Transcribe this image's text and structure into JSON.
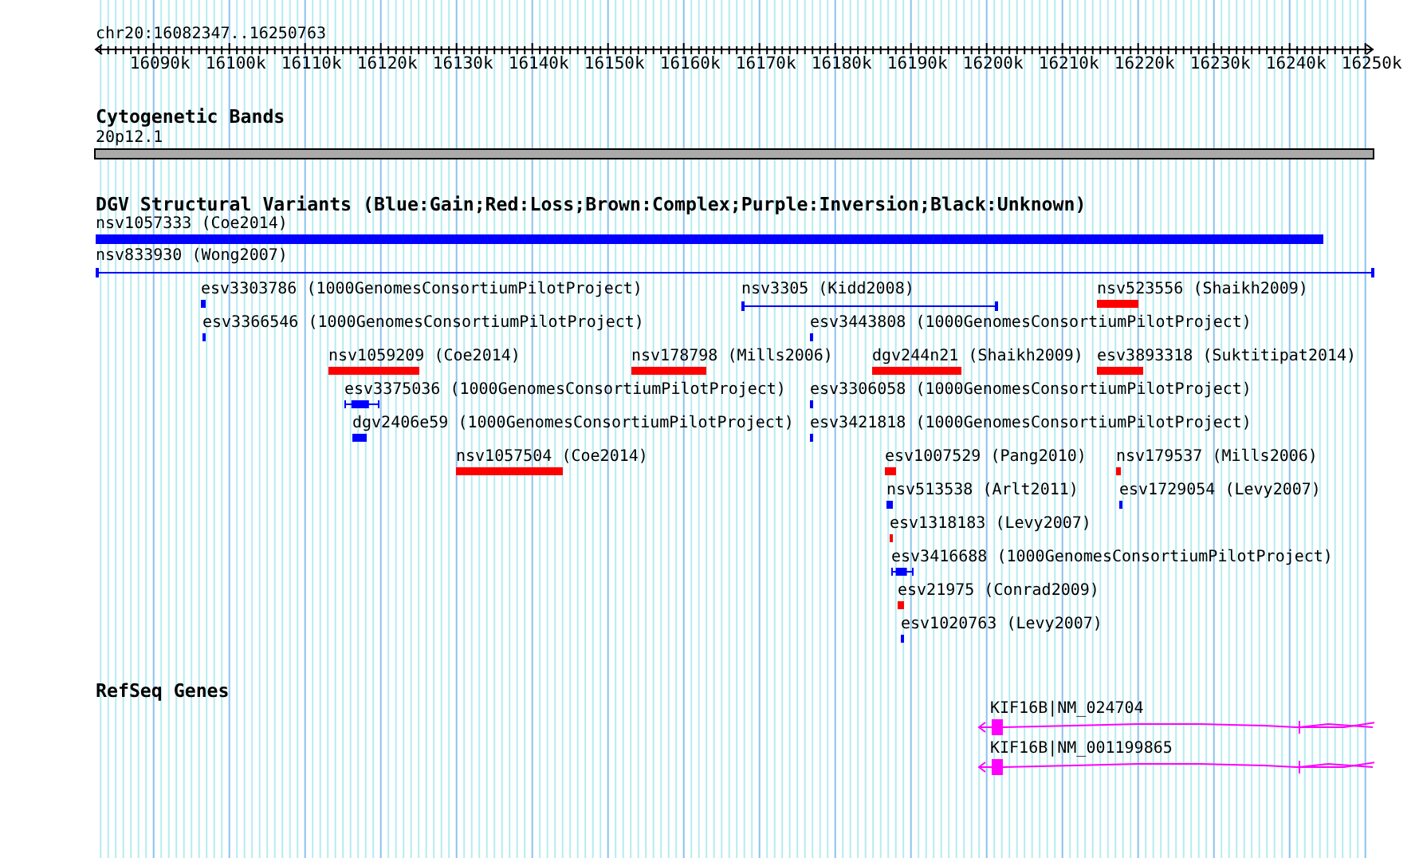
{
  "ruler": {
    "label": "chr20:16082347..16250763",
    "ticks": [
      "16090k",
      "16100k",
      "16110k",
      "16120k",
      "16130k",
      "16140k",
      "16150k",
      "16160k",
      "16170k",
      "16180k",
      "16190k",
      "16200k",
      "16210k",
      "16220k",
      "16230k",
      "16240k",
      "16250k"
    ]
  },
  "cytogenetic_bands": {
    "title": "Cytogenetic Bands",
    "band_label": "20p12.1"
  },
  "structural_variants": {
    "title": "DGV Structural Variants (Blue:Gain;Red:Loss;Brown:Complex;Purple:Inversion;Black:Unknown)",
    "features": [
      {
        "label": "nsv1057333 (Coe2014)",
        "kind": "bar",
        "color": "#0000ff"
      },
      {
        "label": "nsv833930 (Wong2007)",
        "kind": "span",
        "color": "#0000ff"
      },
      {
        "label": "esv3303786 (1000GenomesConsortiumPilotProject)",
        "kind": "bar",
        "color": "#0000ff"
      },
      {
        "label": "nsv3305 (Kidd2008)",
        "kind": "span",
        "color": "#0000ff"
      },
      {
        "label": "nsv523556 (Shaikh2009)",
        "kind": "bar",
        "color": "#ff0000"
      },
      {
        "label": "esv3366546 (1000GenomesConsortiumPilotProject)",
        "kind": "bar",
        "color": "#0000ff"
      },
      {
        "label": "esv3443808 (1000GenomesConsortiumPilotProject)",
        "kind": "bar",
        "color": "#0000ff"
      },
      {
        "label": "nsv1059209 (Coe2014)",
        "kind": "bar",
        "color": "#ff0000"
      },
      {
        "label": "nsv178798 (Mills2006)",
        "kind": "bar",
        "color": "#ff0000"
      },
      {
        "label": "dgv244n21 (Shaikh2009)",
        "kind": "bar",
        "color": "#ff0000"
      },
      {
        "label": "esv3893318 (Suktitipat2014)",
        "kind": "bar",
        "color": "#ff0000"
      },
      {
        "label": "esv3375036 (1000GenomesConsortiumPilotProject)",
        "kind": "whisker",
        "color": "#0000ff"
      },
      {
        "label": "esv3306058 (1000GenomesConsortiumPilotProject)",
        "kind": "bar",
        "color": "#0000ff"
      },
      {
        "label": "dgv2406e59 (1000GenomesConsortiumPilotProject)",
        "kind": "bar",
        "color": "#0000ff"
      },
      {
        "label": "esv3421818 (1000GenomesConsortiumPilotProject)",
        "kind": "bar",
        "color": "#0000ff"
      },
      {
        "label": "nsv1057504 (Coe2014)",
        "kind": "bar",
        "color": "#ff0000"
      },
      {
        "label": "esv1007529 (Pang2010)",
        "kind": "bar",
        "color": "#ff0000"
      },
      {
        "label": "nsv179537 (Mills2006)",
        "kind": "bar",
        "color": "#ff0000"
      },
      {
        "label": "nsv513538 (Arlt2011)",
        "kind": "bar",
        "color": "#0000ff"
      },
      {
        "label": "esv1729054 (Levy2007)",
        "kind": "bar",
        "color": "#0000ff"
      },
      {
        "label": "esv1318183 (Levy2007)",
        "kind": "bar",
        "color": "#ff0000"
      },
      {
        "label": "esv3416688 (1000GenomesConsortiumPilotProject)",
        "kind": "whisker",
        "color": "#0000ff"
      },
      {
        "label": "esv21975 (Conrad2009)",
        "kind": "bar",
        "color": "#ff0000"
      },
      {
        "label": "esv1020763 (Levy2007)",
        "kind": "bar",
        "color": "#0000ff"
      }
    ]
  },
  "refseq_genes": {
    "title": "RefSeq Genes",
    "genes": [
      {
        "label": "KIF16B|NM_024704"
      },
      {
        "label": "KIF16B|NM_001199865"
      }
    ]
  }
}
